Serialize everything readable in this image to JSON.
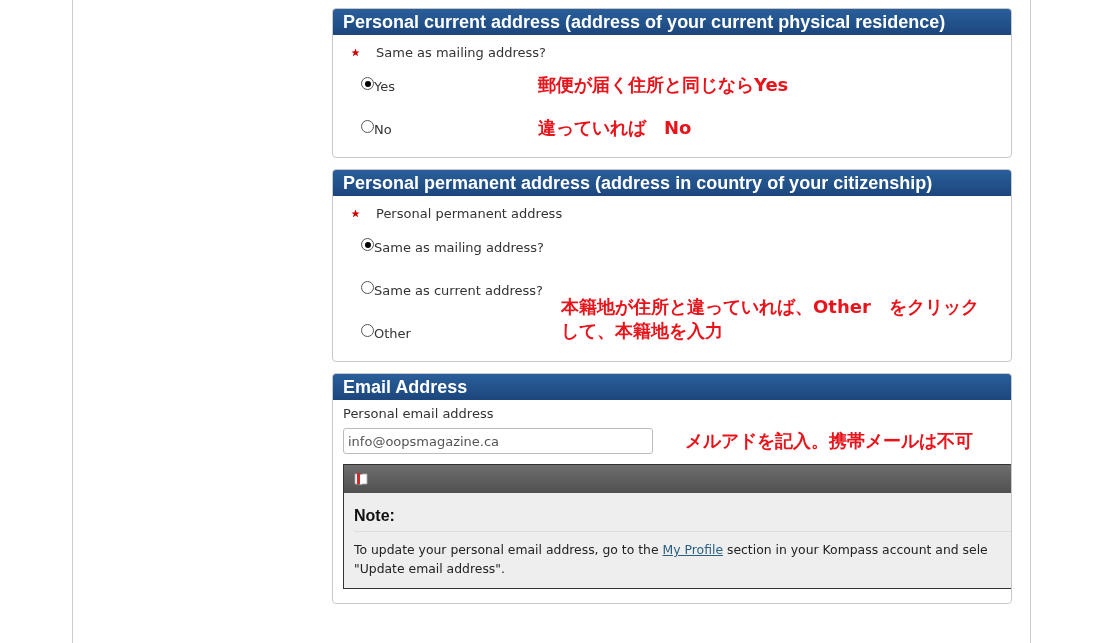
{
  "sections": [
    {
      "kind": "radio",
      "title": "Personal current address (address of your current physical residence)",
      "question": {
        "label": "Same as mailing address?",
        "required": true
      },
      "options": [
        {
          "label": "Yes",
          "selected": true,
          "annotation": [
            "郵便が届く住所と同じならYes"
          ]
        },
        {
          "label": "No",
          "selected": false,
          "annotation": [
            "違っていれば　No"
          ]
        }
      ]
    },
    {
      "kind": "radio",
      "title": "Personal permanent address (address in country of your citizenship)",
      "question": {
        "label": "Personal permanent address",
        "required": true
      },
      "options": [
        {
          "label": "Same as mailing address?",
          "selected": true
        },
        {
          "label": "Same as current address?",
          "selected": false
        },
        {
          "label": "Other",
          "selected": false,
          "annotation": [
            "本籍地が住所と違っていれば、Other　をクリック",
            "して、本籍地を入力"
          ]
        }
      ]
    },
    {
      "kind": "email",
      "title": "Email Address",
      "field": {
        "label": "Personal email address",
        "value": "info@oopsmagazine.ca",
        "annotation": "メルアドを記入。携帯メールは不可"
      },
      "note": {
        "heading": "Note:",
        "text_before": "To update your personal email address, go to the ",
        "link": "My Profile",
        "text_after": " section in your Kompass account and sele",
        "text_line2": "\"Update email address\"."
      }
    }
  ]
}
